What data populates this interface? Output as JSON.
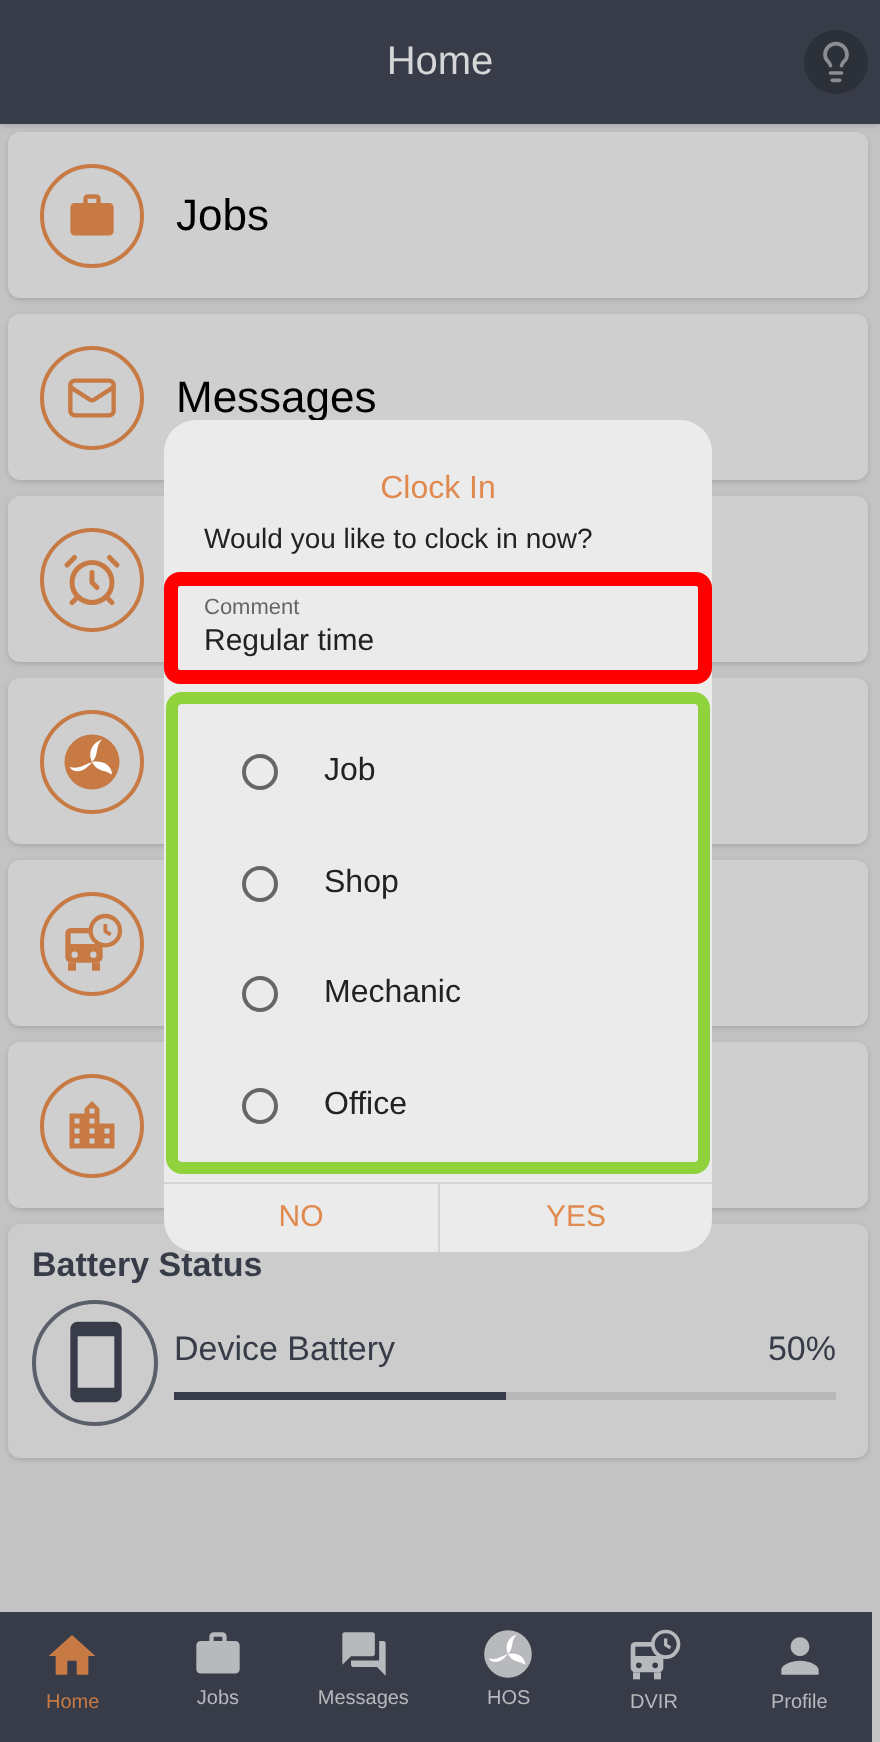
{
  "header": {
    "title": "Home"
  },
  "menu": [
    {
      "kind": "jobs",
      "label": "Jobs"
    },
    {
      "kind": "messages",
      "label": "Messages"
    },
    {
      "kind": "alarm"
    },
    {
      "kind": "hos"
    },
    {
      "kind": "dvir"
    },
    {
      "kind": "building"
    }
  ],
  "battery": {
    "title": "Battery Status",
    "name": "Device Battery",
    "reading": "50%",
    "level": 0.5
  },
  "dialog": {
    "title": "Clock In",
    "message": "Would you like to clock in now?",
    "comment": {
      "label": "Comment",
      "value": "Regular time",
      "highlighted": true
    },
    "options_highlighted": true,
    "options": [
      {
        "label": "Job",
        "selected": false
      },
      {
        "label": "Shop",
        "selected": false
      },
      {
        "label": "Mechanic",
        "selected": false
      },
      {
        "label": "Office",
        "selected": false
      }
    ],
    "buttons": [
      "NO",
      "YES"
    ]
  },
  "tabs": [
    {
      "kind": "home",
      "label": "Home",
      "selected": true
    },
    {
      "kind": "jobs",
      "label": "Jobs",
      "selected": false
    },
    {
      "kind": "messages",
      "label": "Messages",
      "selected": false
    },
    {
      "kind": "hos",
      "label": "HOS",
      "selected": false
    },
    {
      "kind": "dvir",
      "label": "DVIR",
      "selected": false
    },
    {
      "kind": "profile",
      "label": "Profile",
      "selected": false
    }
  ]
}
